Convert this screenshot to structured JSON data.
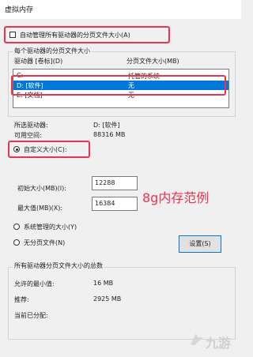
{
  "window": {
    "title": "虚拟内存"
  },
  "auto_manage": {
    "label": "自动管理所有驱动器的分页文件大小(A)",
    "checked": false
  },
  "drives_group": {
    "legend": "每个驱动器的分页文件大小",
    "col_drive": "驱动器 [卷标](D)",
    "col_size": "分页文件大小(MB)",
    "rows": [
      {
        "drive": "C:",
        "size": "托管的系统"
      },
      {
        "drive": "D:      [软件]",
        "size": "无"
      },
      {
        "drive": "E:      [文档]",
        "size": "无"
      }
    ]
  },
  "selected_drive": {
    "label": "所选驱动器:",
    "value": "D:  [软件]"
  },
  "free_space": {
    "label": "可用空间:",
    "value": "88316 MB"
  },
  "custom_size": {
    "label": "自定义大小(C):",
    "initial_label": "初始大小(MB)(I):",
    "initial_value": "12288",
    "max_label": "最大值(MB)(X):",
    "max_value": "16384"
  },
  "system_managed": {
    "label": "系统管理的大小(Y)"
  },
  "no_paging": {
    "label": "无分页文件(N)"
  },
  "set_button": {
    "label": "设置(S)"
  },
  "annotation": {
    "text": "8g内存范例"
  },
  "total_group": {
    "legend": "所有驱动器分页文件大小的总数",
    "min_label": "允许的最小值:",
    "min_value": "16 MB",
    "rec_label": "推荐:",
    "rec_value": "2925 MB",
    "cur_label": "当前已分配:",
    "cur_value": ""
  },
  "watermark": {
    "text": "九游"
  },
  "colors": {
    "highlight": "#e8344e",
    "selection": "#0078d7"
  }
}
